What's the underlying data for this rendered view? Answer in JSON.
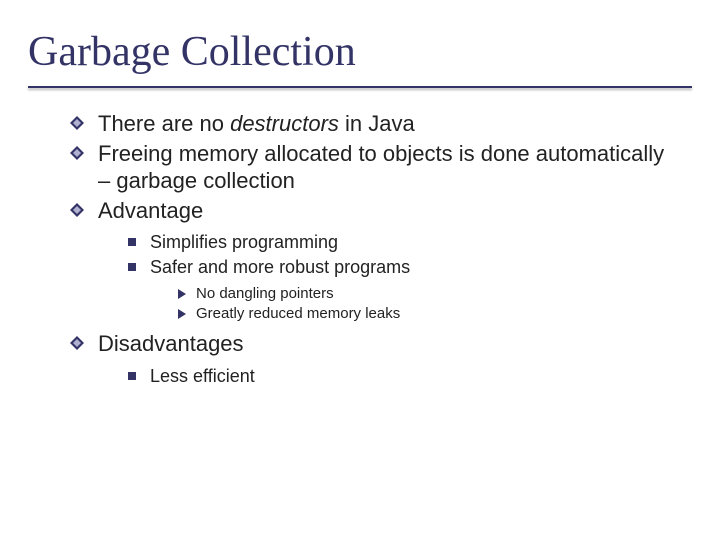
{
  "title": "Garbage Collection",
  "bullets": {
    "b1_pre": "There are no ",
    "b1_em": "destructors",
    "b1_post": " in Java",
    "b2": "Freeing memory allocated to objects is done automatically – garbage collection",
    "b3": "Advantage",
    "b3_sub1": "Simplifies programming",
    "b3_sub2": "Safer and more robust programs",
    "b3_sub2_a": "No dangling pointers",
    "b3_sub2_b": "Greatly reduced memory leaks",
    "b4": "Disadvantages",
    "b4_sub1": "Less efficient"
  }
}
